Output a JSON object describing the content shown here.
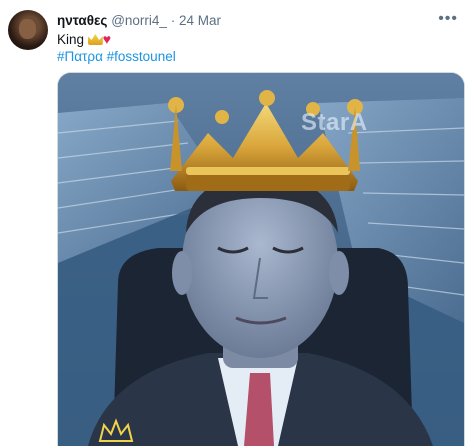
{
  "tweet": {
    "display_name": "ηνταθες",
    "handle": "@norri4_",
    "separator": "·",
    "date": "24 Mar",
    "more_icon": "more-dots-icon",
    "text": "King",
    "emojis": [
      "crown-icon",
      "heart-icon"
    ],
    "hashtags": [
      "#Πατρα",
      "#fosstounel"
    ]
  },
  "media": {
    "background_text": "StarA",
    "overlay_icon": "crown-icon"
  }
}
